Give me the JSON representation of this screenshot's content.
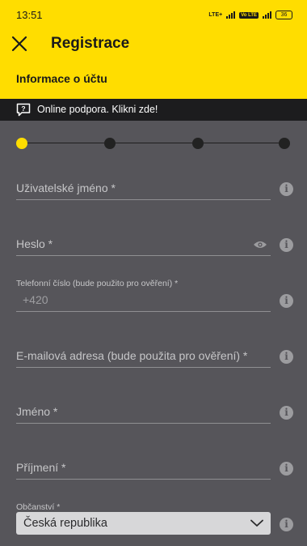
{
  "status_bar": {
    "time": "13:51",
    "network": "LTE+",
    "volte": "Vo LTE",
    "battery": "36"
  },
  "header": {
    "close_icon": "close-icon",
    "title": "Registrace",
    "section": "Informace o účtu"
  },
  "support": {
    "icon": "help-chat-icon",
    "text": "Online podpora. Klikni zde!"
  },
  "stepper": {
    "total_steps": 4,
    "current_step": 1
  },
  "form": {
    "username": {
      "label": "Uživatelské jméno *"
    },
    "password": {
      "label": "Heslo *",
      "toggle_icon": "eye-icon"
    },
    "phone": {
      "label": "Telefonní číslo (bude použito pro ověření) *",
      "value": "+420"
    },
    "email": {
      "label": "E-mailová adresa (bude použita pro ověření) *"
    },
    "first_name": {
      "label": "Jméno *"
    },
    "last_name": {
      "label": "Příjmení *"
    },
    "citizenship": {
      "label": "Občanství *",
      "value": "Česká republika",
      "icon": "chevron-down-icon"
    }
  },
  "info_icon_glyph": "i",
  "colors": {
    "brand_yellow": "#ffdd00",
    "background": "#56555a",
    "support_bar": "#1c1c1e"
  }
}
